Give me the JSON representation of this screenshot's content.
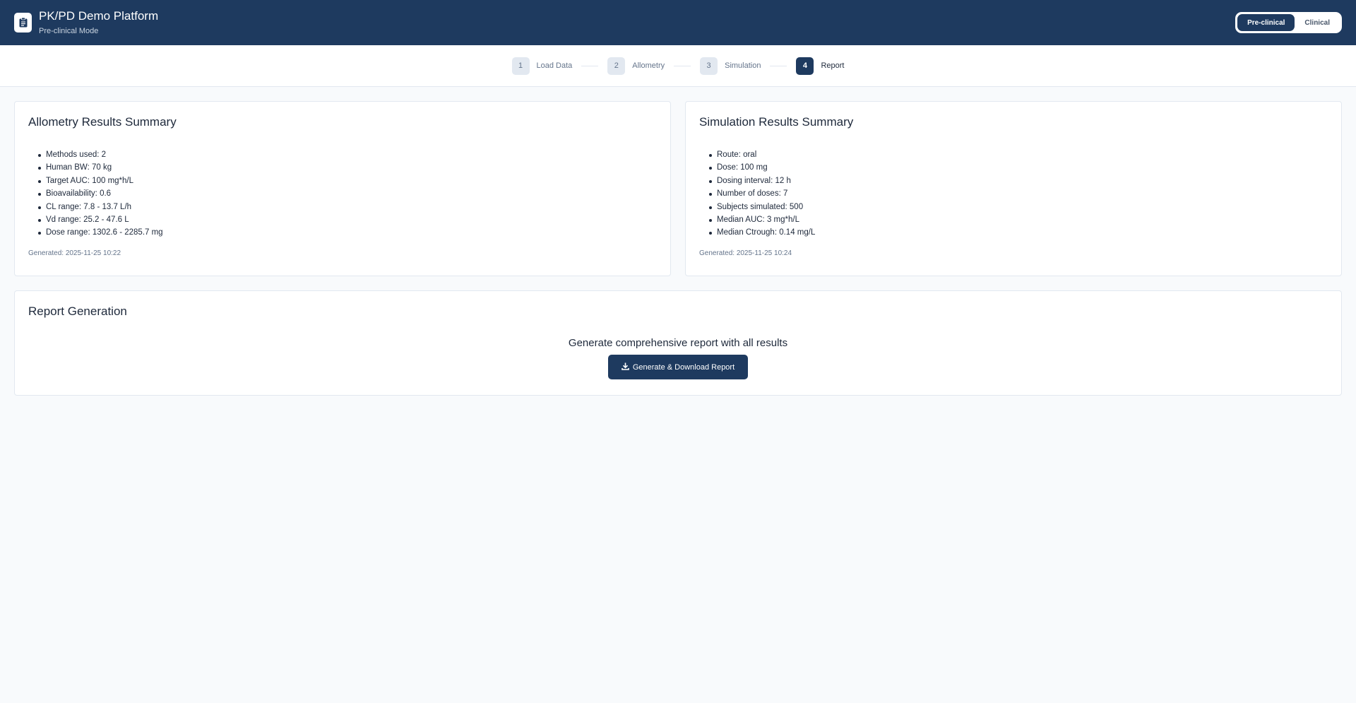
{
  "header": {
    "title": "PK/PD Demo Platform",
    "subtitle": "Pre-clinical Mode",
    "logo_icon": "clipboard-icon",
    "modes": [
      {
        "label": "Pre-clinical",
        "active": true
      },
      {
        "label": "Clinical",
        "active": false
      }
    ]
  },
  "stepper": {
    "steps": [
      {
        "num": "1",
        "label": "Load Data"
      },
      {
        "num": "2",
        "label": "Allometry"
      },
      {
        "num": "3",
        "label": "Simulation"
      },
      {
        "num": "4",
        "label": "Report"
      }
    ],
    "active_step": 4
  },
  "allometry": {
    "title": "Allometry Results Summary",
    "items": [
      "Methods used: 2",
      "Human BW: 70 kg",
      "Target AUC: 100 mg*h/L",
      "Bioavailability: 0.6",
      "CL range: 7.8 - 13.7 L/h",
      "Vd range: 25.2 - 47.6 L",
      "Dose range: 1302.6 - 2285.7 mg"
    ],
    "generated": "Generated: 2025-11-25 10:22"
  },
  "simulation": {
    "title": "Simulation Results Summary",
    "items": [
      "Route: oral",
      "Dose: 100 mg",
      "Dosing interval: 12 h",
      "Number of doses: 7",
      "Subjects simulated: 500",
      "Median AUC: 3 mg*h/L",
      "Median Ctrough: 0.14 mg/L"
    ],
    "generated": "Generated: 2025-11-25 10:24"
  },
  "report": {
    "title": "Report Generation",
    "prompt": "Generate comprehensive report with all results",
    "button_label": "Generate & Download Report",
    "button_icon": "download-icon"
  },
  "colors": {
    "primary": "#1e3a5f",
    "background": "#f8fafc",
    "border": "#e2e8f0"
  }
}
